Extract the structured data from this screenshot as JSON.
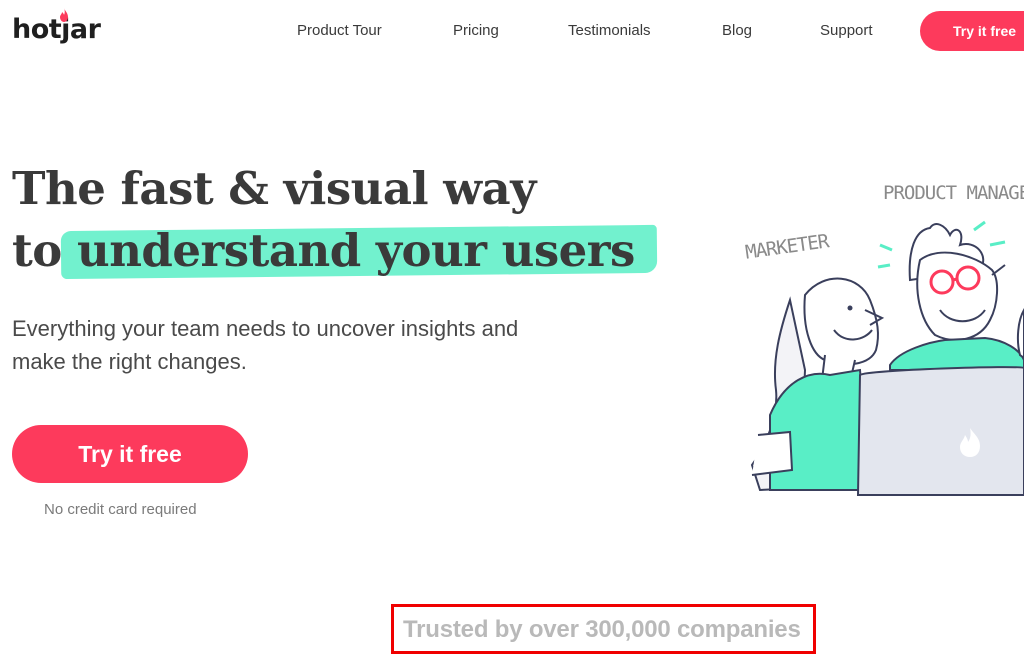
{
  "header": {
    "logo_text": "hotjar",
    "nav": [
      {
        "label": "Product Tour"
      },
      {
        "label": "Pricing"
      },
      {
        "label": "Testimonials"
      },
      {
        "label": "Blog"
      },
      {
        "label": "Support"
      }
    ],
    "cta_label": "Try it free"
  },
  "hero": {
    "headline_line1": "The fast & visual way",
    "headline_to": "to",
    "headline_highlight": "understand your users",
    "subtitle": "Everything your team needs to uncover insights and make the right changes.",
    "cta_label": "Try it free",
    "cta_note": "No credit card required"
  },
  "illustration": {
    "label_product_manager": "PRODUCT MANAGER",
    "label_marketer": "MARKETER"
  },
  "trusted": {
    "text": "Trusted by over 300,000 companies"
  },
  "colors": {
    "brand": "#fd3a5c",
    "highlight": "#59eec6",
    "annotation_box": "#f00000"
  }
}
